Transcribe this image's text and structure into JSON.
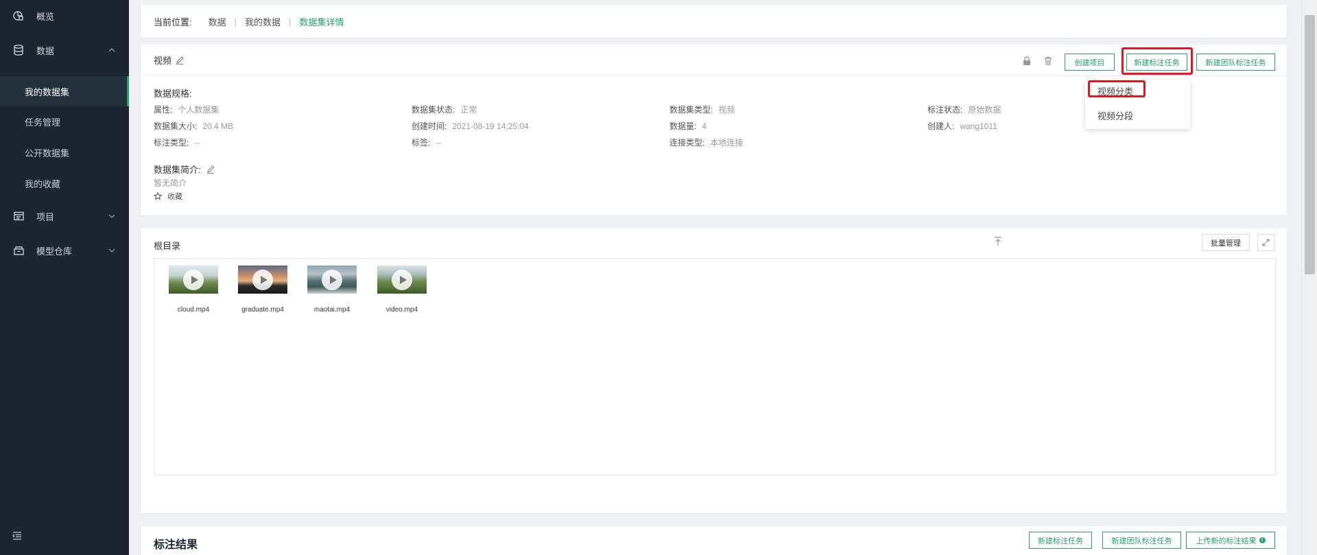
{
  "sidebar": {
    "items": [
      {
        "label": "概览",
        "icon": "overview-icon"
      },
      {
        "label": "数据",
        "icon": "database-icon"
      },
      {
        "label": "项目",
        "icon": "project-icon"
      },
      {
        "label": "模型仓库",
        "icon": "model-repo-icon"
      }
    ],
    "sub_items": [
      {
        "label": "我的数据集",
        "active": true
      },
      {
        "label": "任务管理"
      },
      {
        "label": "公开数据集"
      },
      {
        "label": "我的收藏"
      }
    ]
  },
  "breadcrumb": {
    "label": "当前位置:",
    "items": [
      "数据",
      "我的数据",
      "数据集详情"
    ]
  },
  "dataset": {
    "title": "视频",
    "buttons": {
      "create_project": "创建项目",
      "new_label_task": "新建标注任务",
      "new_team_label_task": "新建团队标注任务"
    },
    "spec_title": "数据规格:",
    "fields": [
      {
        "k": "属性:",
        "v": "个人数据集"
      },
      {
        "k": "数据集状态:",
        "v": "正常"
      },
      {
        "k": "数据集类型:",
        "v": "视频"
      },
      {
        "k": "标注状态:",
        "v": "原始数据"
      },
      {
        "k": "数据集大小:",
        "v": "20.4 MB"
      },
      {
        "k": "创建时间:",
        "v": "2021-08-19 14:25:04"
      },
      {
        "k": "数据量:",
        "v": "4"
      },
      {
        "k": "创建人:",
        "v": "wang1011"
      },
      {
        "k": "标注类型:",
        "v": "--"
      },
      {
        "k": "标签:",
        "v": "--"
      },
      {
        "k": "连接类型:",
        "v": "本地连接"
      }
    ],
    "intro_title": "数据集简介:",
    "intro_text": "暂无简介",
    "favorite": "收藏"
  },
  "dropdown": {
    "items": [
      "视频分类",
      "视频分段"
    ]
  },
  "files": {
    "title": "根目录",
    "batch_manage": "批量管理",
    "items": [
      {
        "name": "cloud.mp4"
      },
      {
        "name": "graduate.mp4"
      },
      {
        "name": "maotai.mp4"
      },
      {
        "name": "video.mp4"
      }
    ]
  },
  "results": {
    "title": "标注结果",
    "buttons": {
      "new_label_task": "新建标注任务",
      "new_team_label_task": "新建团队标注任务",
      "upload_results": "上传新的标注结果"
    }
  },
  "colors": {
    "accent": "#25a36f",
    "sidebar_bg": "#1b2431",
    "highlight": "#e8151b"
  }
}
